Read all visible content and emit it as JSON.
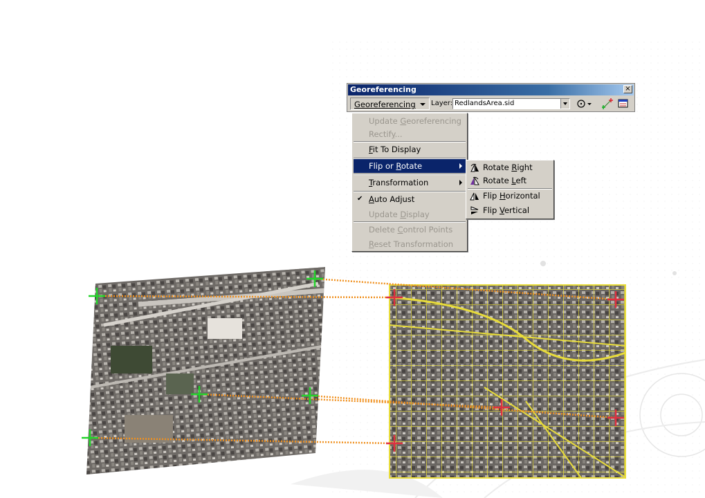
{
  "toolbar": {
    "title": "Georeferencing",
    "close_glyph": "×",
    "menu_button_label": "Georeferencing",
    "layer_label": "Layer:",
    "layer_value": "RedlandsArea.sid",
    "tools": [
      "rotate-tool-icon",
      "add-control-points-icon",
      "link-table-icon"
    ]
  },
  "menu": {
    "items": [
      {
        "pre": "Update ",
        "key": "G",
        "post": "eoreferencing",
        "enabled": false
      },
      {
        "pre": "Rectif",
        "key": "y",
        "post": "...",
        "enabled": false
      },
      {
        "pre": "",
        "key": "F",
        "post": "it To Display",
        "enabled": true
      },
      {
        "pre": "Flip or ",
        "key": "R",
        "post": "otate",
        "enabled": true,
        "submenu": true
      },
      {
        "pre": "",
        "key": "T",
        "post": "ransformation",
        "enabled": true,
        "submenu": true
      },
      {
        "pre": "",
        "key": "A",
        "post": "uto Adjust",
        "enabled": true,
        "checked": true
      },
      {
        "pre": "Update ",
        "key": "D",
        "post": "isplay",
        "enabled": false
      },
      {
        "pre": "Delete ",
        "key": "C",
        "post": "ontrol Points",
        "enabled": false
      },
      {
        "pre": "",
        "key": "R",
        "post": "eset Transformation",
        "enabled": false
      }
    ],
    "check_glyph": "✔"
  },
  "submenu": {
    "items": [
      {
        "pre": "Rotate ",
        "key": "R",
        "post": "ight",
        "icon": "rotate-right-icon"
      },
      {
        "pre": "Rotate ",
        "key": "L",
        "post": "eft",
        "icon": "rotate-left-icon"
      },
      {
        "pre": "Flip ",
        "key": "H",
        "post": "orizontal",
        "icon": "flip-horizontal-icon"
      },
      {
        "pre": "Flip ",
        "key": "V",
        "post": "ertical",
        "icon": "flip-vertical-icon"
      }
    ]
  },
  "colors": {
    "source_marker": "#22d42a",
    "target_marker": "#e03040",
    "link_line": "#f0901e",
    "road_vector": "#e8dc3a",
    "menu_highlight": "#0a246a",
    "title_bar": "#0a246a"
  }
}
